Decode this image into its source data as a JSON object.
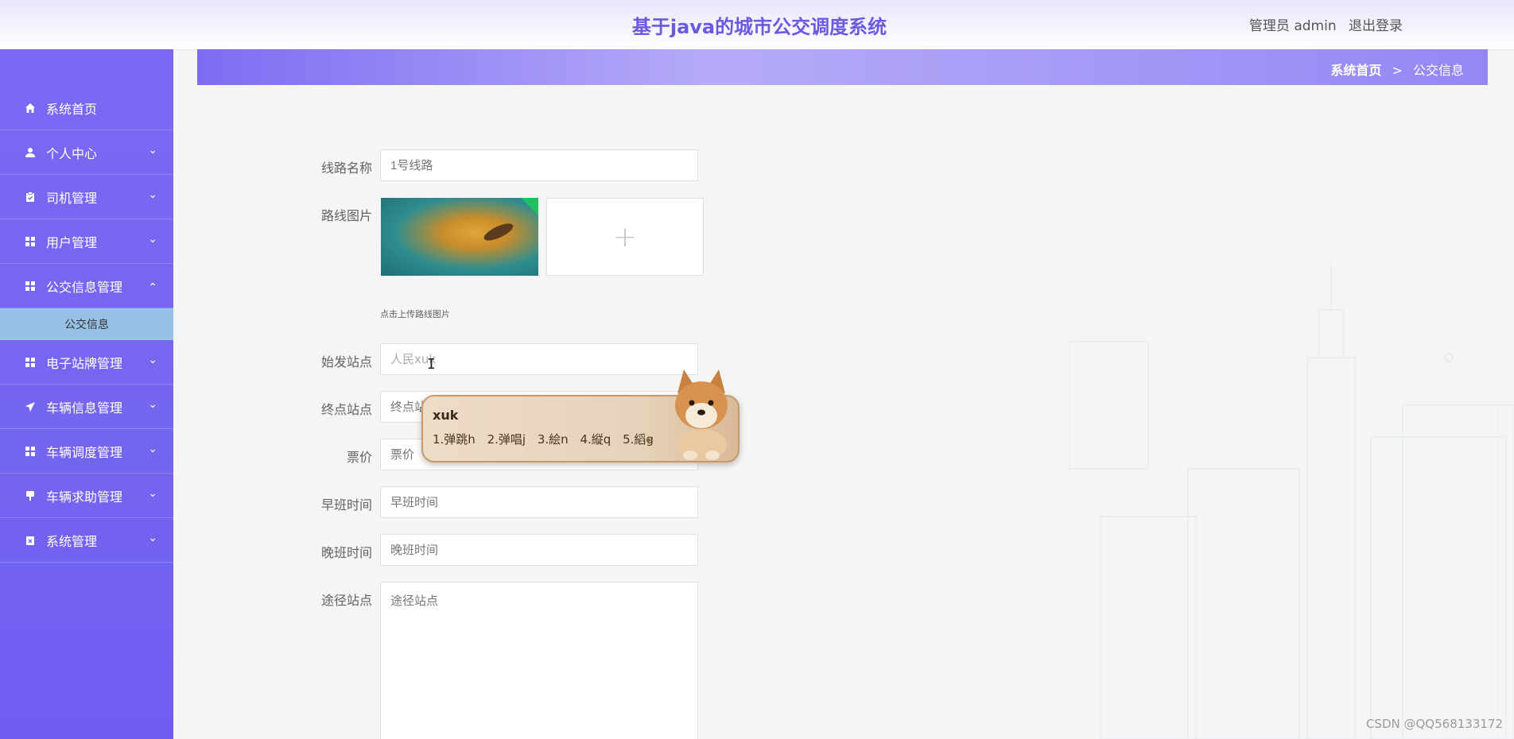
{
  "header": {
    "title": "基于java的城市公交调度系统",
    "user_label": "管理员 admin",
    "logout_label": "退出登录"
  },
  "sidebar": {
    "items": [
      {
        "label": "系统首页",
        "icon": "home-icon"
      },
      {
        "label": "个人中心",
        "icon": "user-icon"
      },
      {
        "label": "司机管理",
        "icon": "clipboard-icon"
      },
      {
        "label": "用户管理",
        "icon": "grid-icon"
      },
      {
        "label": "公交信息管理",
        "icon": "grid-icon"
      },
      {
        "label": "电子站牌管理",
        "icon": "grid-icon"
      },
      {
        "label": "车辆信息管理",
        "icon": "send-icon"
      },
      {
        "label": "车辆调度管理",
        "icon": "grid-icon"
      },
      {
        "label": "车辆求助管理",
        "icon": "bus-stop-icon"
      },
      {
        "label": "系统管理",
        "icon": "clipboard-x-icon"
      }
    ],
    "submenu": {
      "label": "公交信息"
    }
  },
  "breadcrumb": {
    "home": "系统首页",
    "separator": ">",
    "current": "公交信息"
  },
  "form": {
    "route_name": {
      "label": "线路名称",
      "placeholder": "1号线路"
    },
    "route_image": {
      "label": "路线图片",
      "hint": "点击上传路线图片",
      "upload_icon": "+"
    },
    "start_station": {
      "label": "始发站点",
      "value": "人民xuk"
    },
    "end_station": {
      "label": "终点站点",
      "placeholder": "终点站"
    },
    "fare": {
      "label": "票价",
      "placeholder": "票价"
    },
    "morning_time": {
      "label": "早班时间",
      "placeholder": "早班时间"
    },
    "evening_time": {
      "label": "晚班时间",
      "placeholder": "晚班时间"
    },
    "via_stations": {
      "label": "途径站点",
      "placeholder": "途径站点"
    }
  },
  "ime": {
    "composition": "xuk",
    "candidates": [
      "1.弹跳h",
      "2.弹唱j",
      "3.絵n",
      "4.縦q",
      "5.縚g"
    ]
  },
  "watermark": "CSDN @QQ568133172",
  "colors": {
    "primary": "#6a5ae0",
    "sidebar": "#7566ef",
    "submenu_active": "#98c1e8"
  }
}
